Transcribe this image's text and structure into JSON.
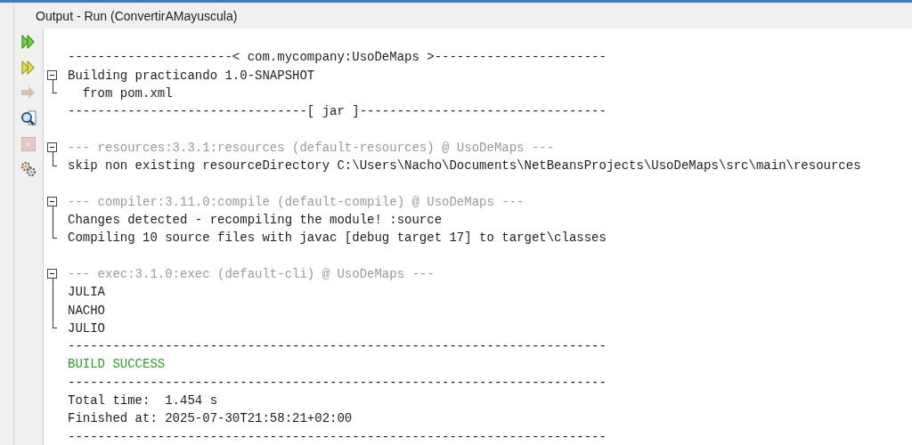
{
  "window": {
    "title": "Output - Run (ConvertirAMayuscula)"
  },
  "toolbar": [
    {
      "kind": "rerun",
      "disabled": false
    },
    {
      "kind": "rerun-params",
      "disabled": false
    },
    {
      "kind": "continue",
      "disabled": true
    },
    {
      "kind": "inspect",
      "disabled": false
    },
    {
      "kind": "stop",
      "disabled": true
    },
    {
      "kind": "settings",
      "disabled": false
    }
  ],
  "console": {
    "entries": [
      {
        "kind": "blank"
      },
      {
        "kind": "plain",
        "text": "----------------------< com.mycompany:UsoDeMaps >-----------------------"
      },
      {
        "kind": "group",
        "expanded": true,
        "header": {
          "kind": "plain",
          "text": "Building practicando 1.0-SNAPSHOT"
        },
        "children": [
          {
            "kind": "plain",
            "text": "  from pom.xml"
          }
        ]
      },
      {
        "kind": "plain",
        "text": "--------------------------------[ jar ]---------------------------------"
      },
      {
        "kind": "blank"
      },
      {
        "kind": "group",
        "expanded": true,
        "header": {
          "kind": "muted",
          "text": "--- resources:3.3.1:resources (default-resources) @ UsoDeMaps ---"
        },
        "children": [
          {
            "kind": "plain",
            "text": "skip non existing resourceDirectory C:\\Users\\Nacho\\Documents\\NetBeansProjects\\UsoDeMaps\\src\\main\\resources"
          }
        ]
      },
      {
        "kind": "blank"
      },
      {
        "kind": "group",
        "expanded": true,
        "header": {
          "kind": "muted",
          "text": "--- compiler:3.11.0:compile (default-compile) @ UsoDeMaps ---"
        },
        "children": [
          {
            "kind": "plain",
            "text": "Changes detected - recompiling the module! :source"
          },
          {
            "kind": "plain",
            "text": "Compiling 10 source files with javac [debug target 17] to target\\classes"
          }
        ]
      },
      {
        "kind": "blank"
      },
      {
        "kind": "group",
        "expanded": true,
        "header": {
          "kind": "muted",
          "text": "--- exec:3.1.0:exec (default-cli) @ UsoDeMaps ---"
        },
        "children": [
          {
            "kind": "plain",
            "text": "JULIA"
          },
          {
            "kind": "plain",
            "text": "NACHO"
          },
          {
            "kind": "plain",
            "text": "JULIO"
          }
        ]
      },
      {
        "kind": "plain",
        "text": "------------------------------------------------------------------------"
      },
      {
        "kind": "success",
        "text": "BUILD SUCCESS"
      },
      {
        "kind": "plain",
        "text": "------------------------------------------------------------------------"
      },
      {
        "kind": "plain",
        "text": "Total time:  1.454 s"
      },
      {
        "kind": "plain",
        "text": "Finished at: 2025-07-30T21:58:21+02:00"
      },
      {
        "kind": "plain",
        "text": "------------------------------------------------------------------------"
      }
    ]
  }
}
